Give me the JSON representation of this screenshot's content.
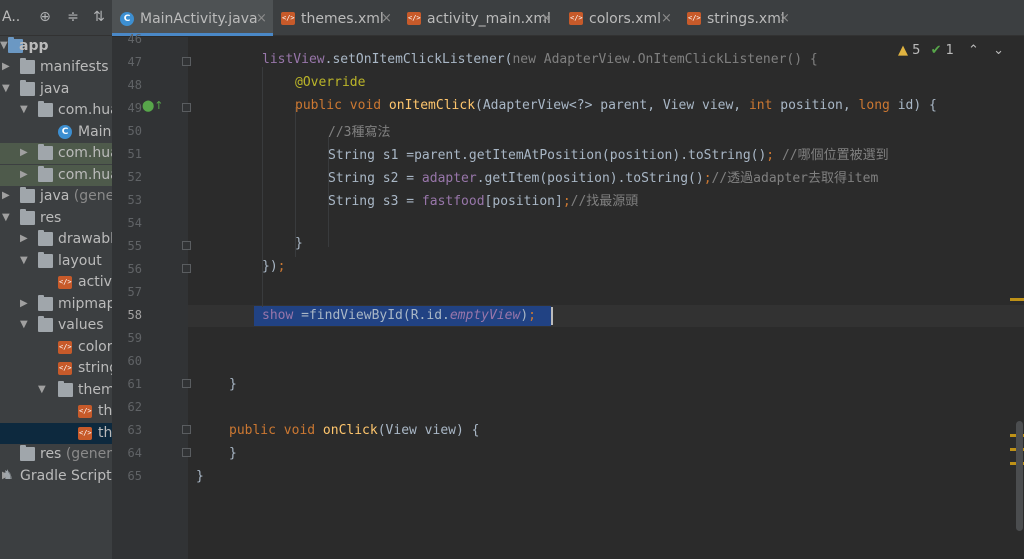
{
  "project_panel": {
    "title": "A..",
    "tree": [
      {
        "label": "app",
        "type": "module"
      },
      {
        "label": "manifests",
        "type": "folder"
      },
      {
        "label": "java",
        "type": "folder"
      },
      {
        "label": "com.hua",
        "type": "package"
      },
      {
        "label": "Main",
        "type": "class"
      },
      {
        "label": "com.hua",
        "type": "package"
      },
      {
        "label": "com.hua",
        "type": "package"
      },
      {
        "label": "java",
        "suffix": "(genera",
        "type": "folder"
      },
      {
        "label": "res",
        "type": "folder"
      },
      {
        "label": "drawabl",
        "type": "folder"
      },
      {
        "label": "layout",
        "type": "folder"
      },
      {
        "label": "activi",
        "type": "xml"
      },
      {
        "label": "mipmap",
        "type": "folder"
      },
      {
        "label": "values",
        "type": "folder"
      },
      {
        "label": "color",
        "type": "xml"
      },
      {
        "label": "string",
        "type": "xml"
      },
      {
        "label": "them",
        "type": "folder"
      },
      {
        "label": "th",
        "type": "xml"
      },
      {
        "label": "th",
        "type": "xml"
      },
      {
        "label": "res",
        "suffix": "(genera",
        "type": "folder"
      },
      {
        "label": "Gradle Scripts",
        "type": "gradle"
      }
    ]
  },
  "tabs": [
    {
      "label": "MainActivity.java",
      "icon": "java-class-icon",
      "active": true
    },
    {
      "label": "themes.xml",
      "icon": "xml-file-icon"
    },
    {
      "label": "activity_main.xml",
      "icon": "xml-file-icon"
    },
    {
      "label": "colors.xml",
      "icon": "xml-file-icon"
    },
    {
      "label": "strings.xml",
      "icon": "xml-file-icon"
    }
  ],
  "close_glyph": "×",
  "inspections": {
    "warnings": "5",
    "ok": "1"
  },
  "editor": {
    "line_numbers": [
      "46",
      "47",
      "48",
      "49",
      "50",
      "51",
      "52",
      "53",
      "54",
      "55",
      "56",
      "57",
      "58",
      "59",
      "60",
      "61",
      "62",
      "63",
      "64",
      "65"
    ],
    "current_line": "58",
    "code": {
      "l47_a": "listView",
      "l47_b": ".setOnItemClickListener(",
      "l47_c": "new AdapterView.OnItemClickListener() {",
      "l48": "@Override",
      "l49_a": "public void ",
      "l49_b": "onItemClick",
      "l49_c": "(AdapterView<?> parent, View view, ",
      "l49_d": "int ",
      "l49_e": "position, ",
      "l49_f": "long ",
      "l49_g": "id) {",
      "l50": "//3種寫法",
      "l51_a": "String s1 =parent.getItemAtPosition(position).toString()",
      "l51_b": "; ",
      "l51_c": "//哪個位置被選到",
      "l52_a": "String s2 = ",
      "l52_b": "adapter",
      "l52_c": ".getItem(position).toString()",
      "l52_d": ";",
      "l52_e": "//透過adapter去取得item",
      "l53_a": "String s3 = ",
      "l53_b": "fastfood",
      "l53_c": "[position]",
      "l53_d": ";",
      "l53_e": "//找最源頭",
      "l55": "}",
      "l56_a": "})",
      "l56_b": ";",
      "l58_a": "show",
      "l58_b": " =findViewById(R.id.",
      "l58_c": "emptyView",
      "l58_d": ")",
      "l58_e": ";",
      "l61": "}",
      "l63_a": "public void ",
      "l63_b": "onClick",
      "l63_c": "(View view) {",
      "l64": "}",
      "l65": "}"
    }
  }
}
